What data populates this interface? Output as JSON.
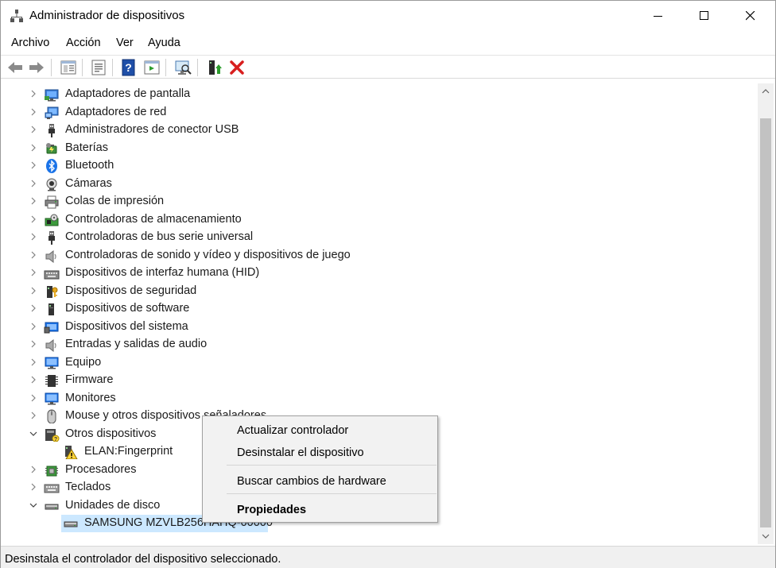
{
  "window": {
    "title": "Administrador de dispositivos"
  },
  "menu": [
    "Archivo",
    "Acción",
    "Ver",
    "Ayuda"
  ],
  "toolbar": {
    "buttons": [
      "back-icon",
      "forward-icon",
      "show-hide-tree-icon",
      "properties-icon",
      "help-icon",
      "action-pane-icon",
      "scan-hardware-icon",
      "update-driver-icon",
      "uninstall-icon"
    ],
    "colors": {
      "uninstall": "#d81e1e",
      "help": "#1f4fa8",
      "update": "#2e9d2e"
    }
  },
  "tree": [
    {
      "label": "Adaptadores de pantalla",
      "icon": "display-adapter-icon",
      "expanded": false
    },
    {
      "label": "Adaptadores de red",
      "icon": "network-adapter-icon",
      "expanded": false
    },
    {
      "label": "Administradores de conector USB",
      "icon": "usb-connector-icon",
      "expanded": false
    },
    {
      "label": "Baterías",
      "icon": "battery-icon",
      "expanded": false
    },
    {
      "label": "Bluetooth",
      "icon": "bluetooth-icon",
      "expanded": false
    },
    {
      "label": "Cámaras",
      "icon": "camera-icon",
      "expanded": false
    },
    {
      "label": "Colas de impresión",
      "icon": "printer-icon",
      "expanded": false
    },
    {
      "label": "Controladoras de almacenamiento",
      "icon": "storage-controller-icon",
      "expanded": false
    },
    {
      "label": "Controladoras de bus serie universal",
      "icon": "usb-controller-icon",
      "expanded": false
    },
    {
      "label": "Controladoras de sonido y vídeo y dispositivos de juego",
      "icon": "sound-icon",
      "expanded": false
    },
    {
      "label": "Dispositivos de interfaz humana (HID)",
      "icon": "hid-icon",
      "expanded": false
    },
    {
      "label": "Dispositivos de seguridad",
      "icon": "security-device-icon",
      "expanded": false
    },
    {
      "label": "Dispositivos de software",
      "icon": "software-device-icon",
      "expanded": false
    },
    {
      "label": "Dispositivos del sistema",
      "icon": "system-device-icon",
      "expanded": false
    },
    {
      "label": "Entradas y salidas de audio",
      "icon": "audio-io-icon",
      "expanded": false
    },
    {
      "label": "Equipo",
      "icon": "computer-icon",
      "expanded": false
    },
    {
      "label": "Firmware",
      "icon": "firmware-icon",
      "expanded": false
    },
    {
      "label": "Monitores",
      "icon": "monitor-icon",
      "expanded": false
    },
    {
      "label": "Mouse y otros dispositivos señaladores",
      "icon": "mouse-icon",
      "expanded": false
    },
    {
      "label": "Otros dispositivos",
      "icon": "other-devices-icon",
      "expanded": true
    },
    {
      "label": "ELAN:Fingerprint",
      "icon": "warning-device-icon",
      "child": true
    },
    {
      "label": "Procesadores",
      "icon": "processor-icon",
      "expanded": false
    },
    {
      "label": "Teclados",
      "icon": "keyboard-icon",
      "expanded": false
    },
    {
      "label": "Unidades de disco",
      "icon": "disk-drive-icon",
      "expanded": true
    },
    {
      "label": "SAMSUNG MZVLB256HAHQ-00000",
      "icon": "disk-icon",
      "child": true,
      "selected": true
    }
  ],
  "context_menu": {
    "update": "Actualizar controlador",
    "uninstall": "Desinstalar el dispositivo",
    "scan": "Buscar cambios de hardware",
    "properties": "Propiedades"
  },
  "status": "Desinstala el controlador del dispositivo seleccionado.",
  "colors": {
    "selection": "#cce8ff",
    "accent": "#0078d7"
  }
}
